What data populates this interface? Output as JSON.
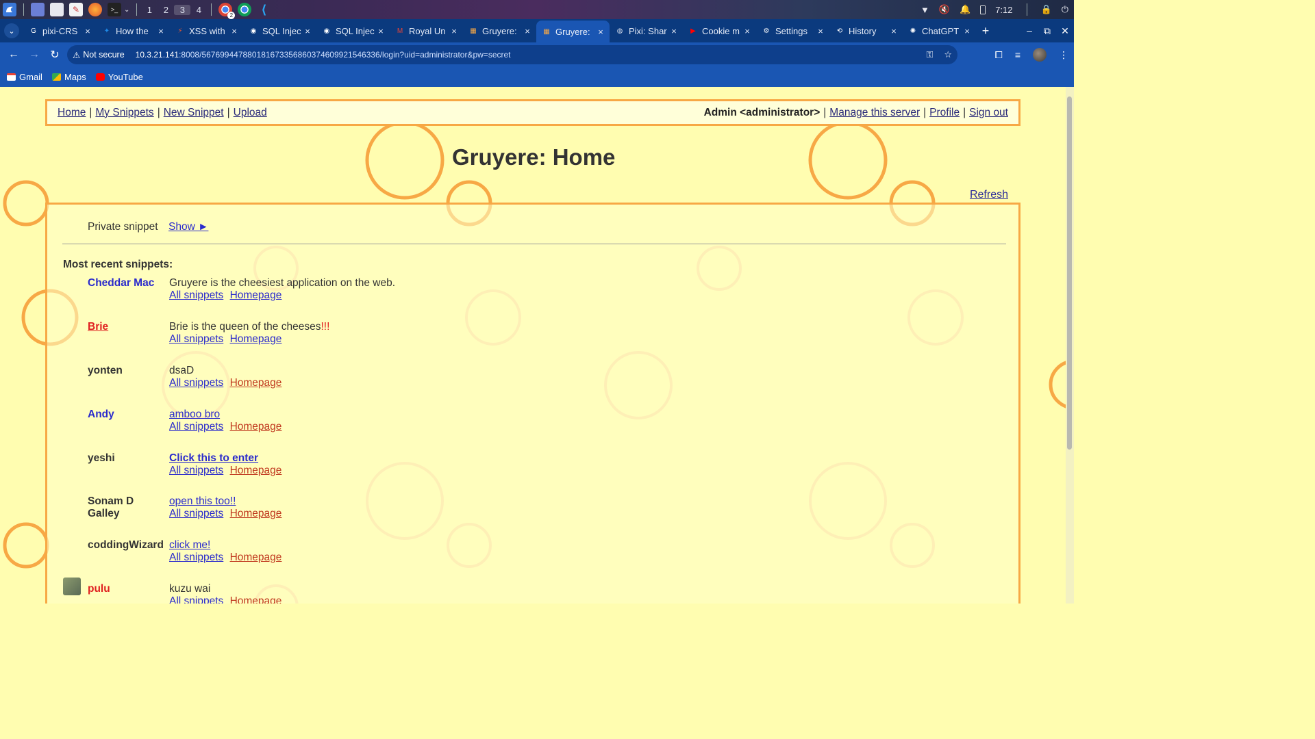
{
  "os": {
    "workspaces": [
      "1",
      "2",
      "3",
      "4"
    ],
    "active_workspace": "3",
    "clock": "7:12",
    "notification_badge": "2"
  },
  "browser": {
    "tabs": [
      {
        "title": "pixi-CRS",
        "icon": "google-icon",
        "color": "#ffffff"
      },
      {
        "title": "How the",
        "icon": "tutorial-icon",
        "color": "#1e88e5"
      },
      {
        "title": "XSS with",
        "icon": "hackerone-icon",
        "color": "#e8552f"
      },
      {
        "title": "SQL Injec",
        "icon": "portswigger-icon",
        "color": "#ffffff"
      },
      {
        "title": "SQL Injec",
        "icon": "portswigger-icon",
        "color": "#ffffff"
      },
      {
        "title": "Royal Un",
        "icon": "gmail-icon",
        "color": "#ea4335"
      },
      {
        "title": "Gruyere:",
        "icon": "gruyere-icon",
        "color": "#f7a845"
      },
      {
        "title": "Gruyere:",
        "icon": "gruyere-icon",
        "color": "#f7a845",
        "active": true
      },
      {
        "title": "Pixi: Shar",
        "icon": "globe-icon",
        "color": "#cfd8e8"
      },
      {
        "title": "Cookie m",
        "icon": "youtube-icon",
        "color": "#ff0000"
      },
      {
        "title": "Settings",
        "icon": "gear-icon",
        "color": "#ffffff"
      },
      {
        "title": "History",
        "icon": "history-icon",
        "color": "#ffffff"
      },
      {
        "title": "ChatGPT",
        "icon": "chatgpt-icon",
        "color": "#ffffff"
      }
    ],
    "security_label": "Not secure",
    "url_host": "10.3.21.141",
    "url_rest": ":8008/567699447880181673356860374609921546336/login?uid=administrator&pw=secret",
    "bookmarks": [
      {
        "label": "Gmail",
        "icon": "gmail-icon"
      },
      {
        "label": "Maps",
        "icon": "maps-icon"
      },
      {
        "label": "YouTube",
        "icon": "youtube-icon"
      }
    ]
  },
  "page": {
    "menu": {
      "home": "Home",
      "my_snippets": "My Snippets",
      "new_snippet": "New Snippet",
      "upload": "Upload",
      "separator": "|",
      "user": "Admin <administrator>",
      "manage": "Manage this server",
      "profile": "Profile",
      "sign_out": "Sign out"
    },
    "title": "Gruyere: Home",
    "refresh": "Refresh",
    "private_snippet_label": "Private snippet",
    "show_link": "Show ►",
    "recent_heading": "Most recent snippets:",
    "all_snippets_label": "All snippets",
    "homepage_label": "Homepage",
    "snippets": [
      {
        "author": "Cheddar Mac",
        "text": "Gruyere is the cheesiest application on the web."
      },
      {
        "author": "Brie",
        "text": "Brie is the queen of the cheeses",
        "suffix": "!!!"
      },
      {
        "author": "yonten",
        "text": "dsaD"
      },
      {
        "author": "Andy",
        "text": "amboo bro"
      },
      {
        "author": "yeshi",
        "text": "Click this to enter"
      },
      {
        "author": "Sonam D Galley",
        "text": "open this too!!"
      },
      {
        "author": "coddingWizard",
        "text": "click me!"
      },
      {
        "author": "pulu",
        "text": "kuzu wai"
      }
    ]
  },
  "colors": {
    "page_bg": "#fffdb0",
    "accent_orange": "#f7a845",
    "chrome_blue": "#1a56b3",
    "link_blue": "#2a2acc",
    "link_red": "#c0381e"
  }
}
